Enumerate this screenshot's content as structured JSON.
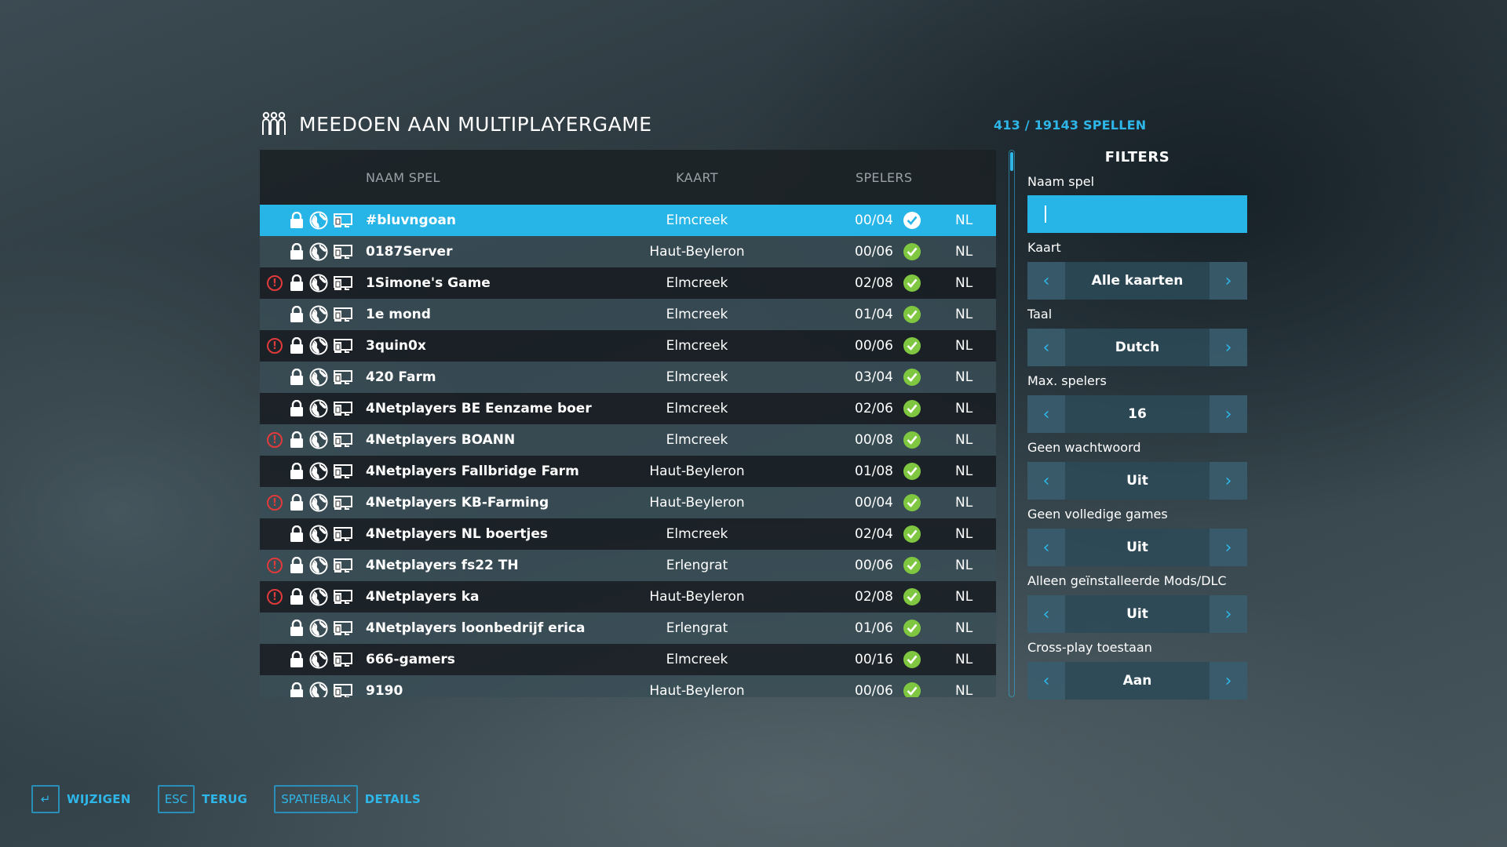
{
  "header": {
    "title": "MEEDOEN AAN MULTIPLAYERGAME",
    "count": "413 / 19143 SPELLEN",
    "icon": "players-group-icon"
  },
  "table": {
    "columns": {
      "name": "NAAM SPEL",
      "map": "KAART",
      "players": "SPELERS"
    },
    "rows": [
      {
        "warning": false,
        "name": "#bluvngoan",
        "map": "Elmcreek",
        "players": "00/04",
        "lang": "NL",
        "selected": true
      },
      {
        "warning": false,
        "name": "0187Server",
        "map": "Haut-Beyleron",
        "players": "00/06",
        "lang": "NL"
      },
      {
        "warning": true,
        "name": "1Simone's Game",
        "map": "Elmcreek",
        "players": "02/08",
        "lang": "NL"
      },
      {
        "warning": false,
        "name": "1e mond",
        "map": "Elmcreek",
        "players": "01/04",
        "lang": "NL"
      },
      {
        "warning": true,
        "name": "3quin0x",
        "map": "Elmcreek",
        "players": "00/06",
        "lang": "NL"
      },
      {
        "warning": false,
        "name": "420 Farm",
        "map": "Elmcreek",
        "players": "03/04",
        "lang": "NL"
      },
      {
        "warning": false,
        "name": "4Netplayers BE Eenzame boer",
        "map": "Elmcreek",
        "players": "02/06",
        "lang": "NL"
      },
      {
        "warning": true,
        "name": "4Netplayers BOANN",
        "map": "Elmcreek",
        "players": "00/08",
        "lang": "NL"
      },
      {
        "warning": false,
        "name": "4Netplayers Fallbridge Farm",
        "map": "Haut-Beyleron",
        "players": "01/08",
        "lang": "NL"
      },
      {
        "warning": true,
        "name": "4Netplayers KB-Farming",
        "map": "Haut-Beyleron",
        "players": "00/04",
        "lang": "NL"
      },
      {
        "warning": false,
        "name": "4Netplayers NL boertjes",
        "map": "Elmcreek",
        "players": "02/04",
        "lang": "NL"
      },
      {
        "warning": true,
        "name": "4Netplayers fs22 TH",
        "map": "Erlengrat",
        "players": "00/06",
        "lang": "NL"
      },
      {
        "warning": true,
        "name": "4Netplayers ka",
        "map": "Haut-Beyleron",
        "players": "02/08",
        "lang": "NL"
      },
      {
        "warning": false,
        "name": "4Netplayers loonbedrijf erica",
        "map": "Erlengrat",
        "players": "01/06",
        "lang": "NL"
      },
      {
        "warning": false,
        "name": "666-gamers",
        "map": "Elmcreek",
        "players": "00/16",
        "lang": "NL"
      },
      {
        "warning": false,
        "name": "9190",
        "map": "Haut-Beyleron",
        "players": "00/06",
        "lang": "NL"
      }
    ]
  },
  "filters": {
    "title": "FILTERS",
    "name_label": "Naam spel",
    "name_value": "",
    "steppers": [
      {
        "id": "map",
        "label": "Kaart",
        "value": "Alle kaarten"
      },
      {
        "id": "language",
        "label": "Taal",
        "value": "Dutch"
      },
      {
        "id": "max-players",
        "label": "Max. spelers",
        "value": "16"
      },
      {
        "id": "no-password",
        "label": "Geen wachtwoord",
        "value": "Uit"
      },
      {
        "id": "not-full",
        "label": "Geen volledige games",
        "value": "Uit"
      },
      {
        "id": "installed-mods",
        "label": "Alleen geïnstalleerde Mods/DLC",
        "value": "Uit"
      },
      {
        "id": "crossplay",
        "label": "Cross-play toestaan",
        "value": "Aan"
      }
    ]
  },
  "footer": {
    "actions": [
      {
        "key": "↵",
        "label": "WIJZIGEN"
      },
      {
        "key": "ESC",
        "label": "TERUG"
      },
      {
        "key": "SPATIEBALK",
        "label": "DETAILS"
      }
    ]
  },
  "colors": {
    "accent": "#27b4e6",
    "check": "#7fc741",
    "warning": "#e03a3a"
  }
}
